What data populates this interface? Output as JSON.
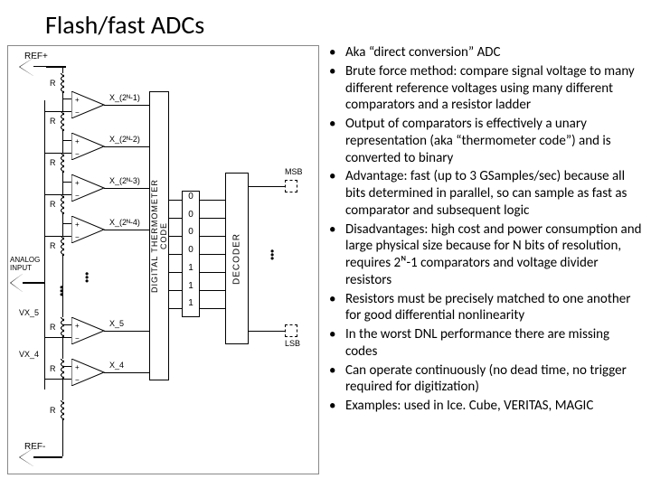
{
  "title": "Flash/fast  ADCs",
  "bullets": [
    "Aka “direct conversion” ADC",
    "Brute force method: compare signal voltage to many different reference voltages using many different comparators and a resistor ladder",
    "Output of comparators is effectively a unary representation (aka “thermometer code”) and is converted to binary",
    "Advantage: fast (up to 3 GSamples/sec) because all bits determined in parallel, so can sample as fast as comparator and subsequent logic",
    "Disadvantages: high cost and power consumption and large physical size because for N bits of resolution, requires 2ᴺ-1 comparators and voltage divider resistors",
    "Resistors must be precisely matched to one another for good differential nonlinearity",
    "In the worst DNL performance there are missing codes",
    "Can operate continuously (no dead time, no trigger required for digitization)",
    "Examples: used in Ice. Cube, VERITAS, MAGIC"
  ],
  "diagram": {
    "ref_plus": "REF+",
    "ref_minus": "REF-",
    "analog_input": "ANALOG\nINPUT",
    "r_label": "R",
    "vx_labels_left": [
      "VX_5",
      "VX_4"
    ],
    "comp_outputs_top": [
      "X_(2ᴺ-1)",
      "X_(2ᴺ-2)",
      "X_(2ᴺ-3)",
      "X_(2ᴺ-4)"
    ],
    "comp_outputs_bot": [
      "X_5",
      "X_4"
    ],
    "therm_box": "DIGITAL THERMOMETER\nCODE",
    "therm_bits": [
      "0",
      "0",
      "0",
      "0",
      "1",
      "1",
      "1"
    ],
    "decoder": "DECODER",
    "msb": "MSB",
    "lsb": "LSB"
  }
}
